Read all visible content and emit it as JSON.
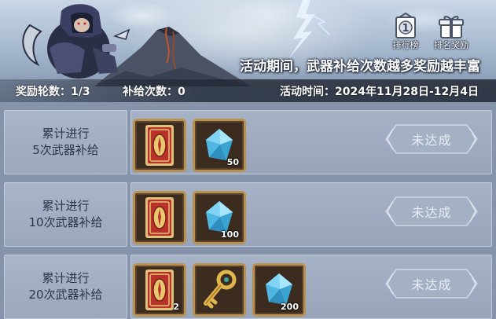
{
  "banner": {
    "tagline": "活动期间，武器补给次数越多奖励越丰富",
    "rank_button": {
      "label": "排行榜",
      "badge": "1"
    },
    "rank_reward_button": {
      "label": "排名奖励"
    }
  },
  "info": {
    "round": "奖励轮数：1/3",
    "supply_count": "补给次数：0",
    "time": "活动时间：2024年11月28日-12月4日"
  },
  "rows": [
    {
      "label_line1": "累计进行",
      "label_line2": "5次武器补给",
      "status": "未达成",
      "items": [
        {
          "icon": "red-card-icon",
          "qty": ""
        },
        {
          "icon": "blue-crystal-icon",
          "qty": "50"
        }
      ]
    },
    {
      "label_line1": "累计进行",
      "label_line2": "10次武器补给",
      "status": "未达成",
      "items": [
        {
          "icon": "red-card-icon",
          "qty": ""
        },
        {
          "icon": "blue-crystal-icon",
          "qty": "100"
        }
      ]
    },
    {
      "label_line1": "累计进行",
      "label_line2": "20次武器补给",
      "status": "未达成",
      "items": [
        {
          "icon": "red-card-icon",
          "qty": "2"
        },
        {
          "icon": "golden-key-icon",
          "qty": ""
        },
        {
          "icon": "blue-crystal-icon",
          "qty": "200"
        }
      ]
    }
  ],
  "colors": {
    "background": "#8593ab",
    "item_border": "#b89050",
    "card_red": "#b8322a",
    "crystal_blue": "#5fc3ea"
  }
}
